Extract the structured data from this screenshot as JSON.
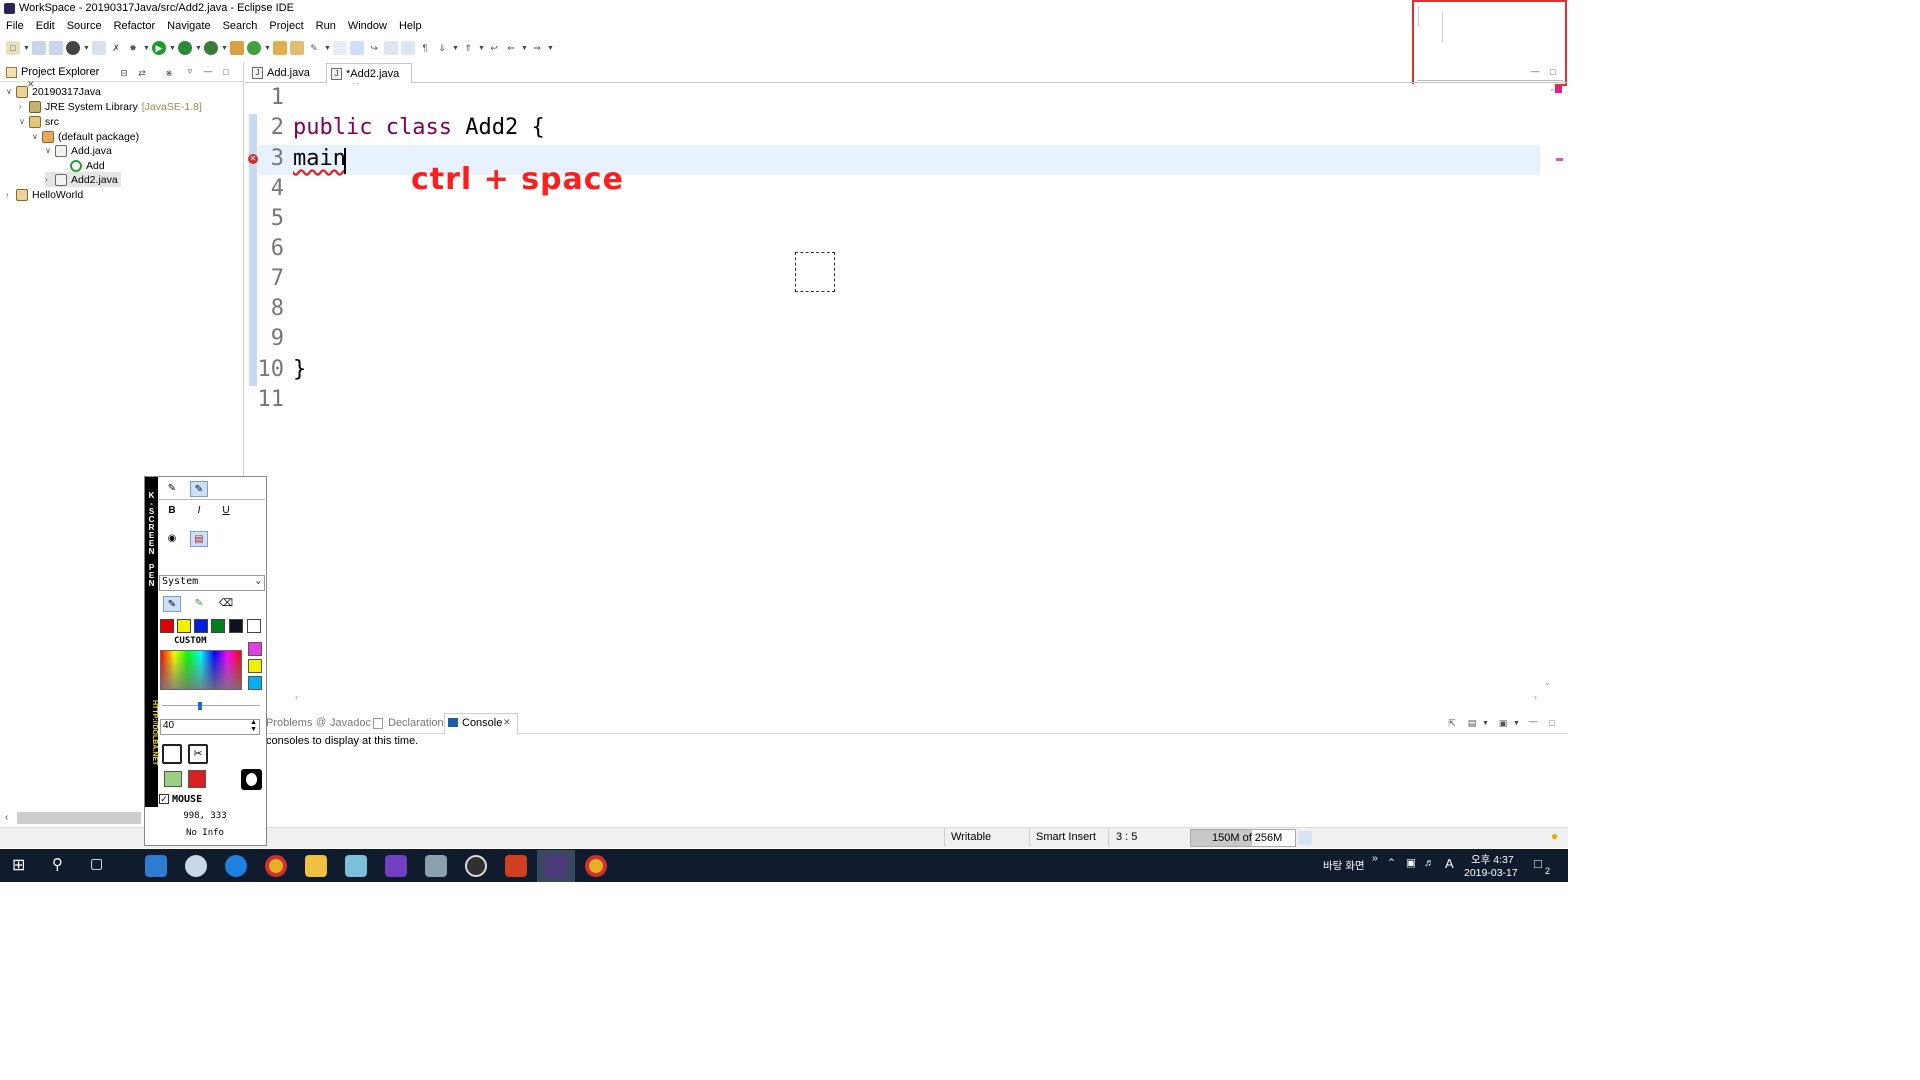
{
  "window": {
    "title": "WorkSpace - 20190317Java/src/Add2.java - Eclipse IDE"
  },
  "menu": [
    "File",
    "Edit",
    "Source",
    "Refactor",
    "Navigate",
    "Search",
    "Project",
    "Run",
    "Window",
    "Help"
  ],
  "project_explorer": {
    "title": "Project Explorer",
    "tree": [
      {
        "label": "20190317Java",
        "twisty": "∨"
      },
      {
        "label": "JRE System Library",
        "decor": "[JavaSE-1.8]",
        "twisty": "›"
      },
      {
        "label": "src",
        "twisty": "∨"
      },
      {
        "label": "(default package)",
        "twisty": "∨"
      },
      {
        "label": "Add.java",
        "twisty": "∨"
      },
      {
        "label": "Add",
        "twisty": ""
      },
      {
        "label": "Add2.java",
        "twisty": "›"
      },
      {
        "label": "HelloWorld",
        "twisty": "›"
      }
    ]
  },
  "editor": {
    "tabs": [
      {
        "label": "Add.java"
      },
      {
        "label": "*Add2.java"
      }
    ],
    "line_numbers": [
      "1",
      "2",
      "3",
      "4",
      "5",
      "6",
      "7",
      "8",
      "9",
      "10",
      "11"
    ],
    "lines": {
      "l2_kw1": "public",
      "l2_kw2": "class",
      "l2_rest": "Add2 {",
      "l3": "main",
      "l10": "}"
    },
    "annotation": "ctrl + space"
  },
  "console": {
    "tabs": [
      "Problems",
      "Javadoc",
      "Declaration",
      "Console"
    ],
    "message": "consoles to display at this time."
  },
  "status": {
    "writable": "Writable",
    "insert_mode": "Smart Insert",
    "position": "3 : 5",
    "heap": "150M of 256M",
    "heap_used_fraction": 0.59
  },
  "screen_pen": {
    "vertical_label": "K-SCREEN PEN",
    "url_label": "HTTP://DOLBA.NET",
    "font_select": "System",
    "custom_label": "CUSTOM",
    "size_value": "40",
    "mouse_label": "MOUSE",
    "coords": "998, 333",
    "info": "No Info",
    "colors": [
      "#e00000",
      "#f0f000",
      "#0020e0",
      "#008020",
      "#101020",
      "#ffffff"
    ],
    "side_colors": [
      "#e040e0",
      "#f0f000",
      "#00b0f0"
    ]
  },
  "taskbar": {
    "desktop_label": "바탕 화면",
    "time": "오후 4:37",
    "date": "2019-03-17",
    "ime": "A",
    "notifications": "2"
  },
  "colors": {
    "keyword": "#7f0055",
    "annotation": "#ff1e1e",
    "current_line": "#e8f2fe"
  }
}
